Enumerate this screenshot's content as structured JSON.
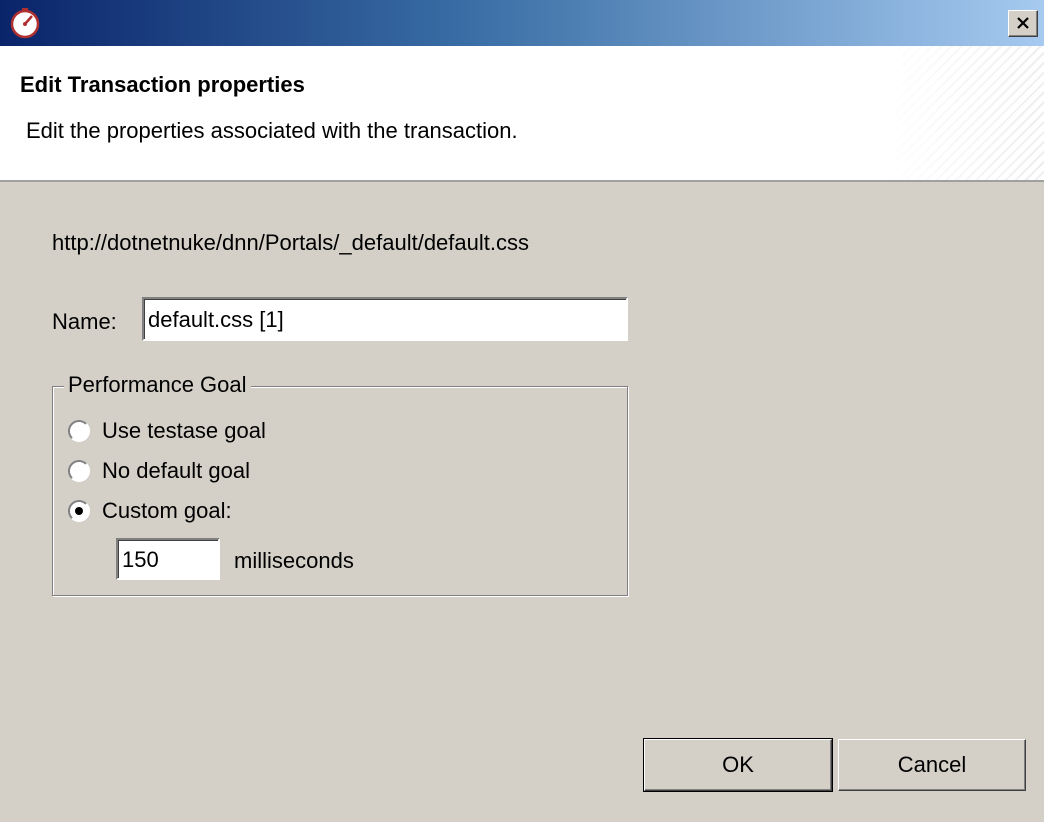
{
  "dialog": {
    "title": "Edit Transaction properties",
    "description": "Edit the properties associated with the transaction."
  },
  "form": {
    "url": "http://dotnetnuke/dnn/Portals/_default/default.css",
    "name_label": "Name:",
    "name_value": "default.css [1]",
    "performance_goal": {
      "legend": "Performance Goal",
      "options": [
        {
          "label": "Use testase goal",
          "selected": false
        },
        {
          "label": "No default goal",
          "selected": false
        },
        {
          "label": "Custom goal:",
          "selected": true
        }
      ],
      "custom_value": "150",
      "unit": "milliseconds"
    }
  },
  "buttons": {
    "ok": "OK",
    "cancel": "Cancel"
  },
  "icons": {
    "app": "stopwatch-icon",
    "close": "close-icon"
  },
  "colors": {
    "titlebar_start": "#0a246a",
    "titlebar_end": "#a6caf0",
    "dialog_bg": "#d4d0c8"
  }
}
